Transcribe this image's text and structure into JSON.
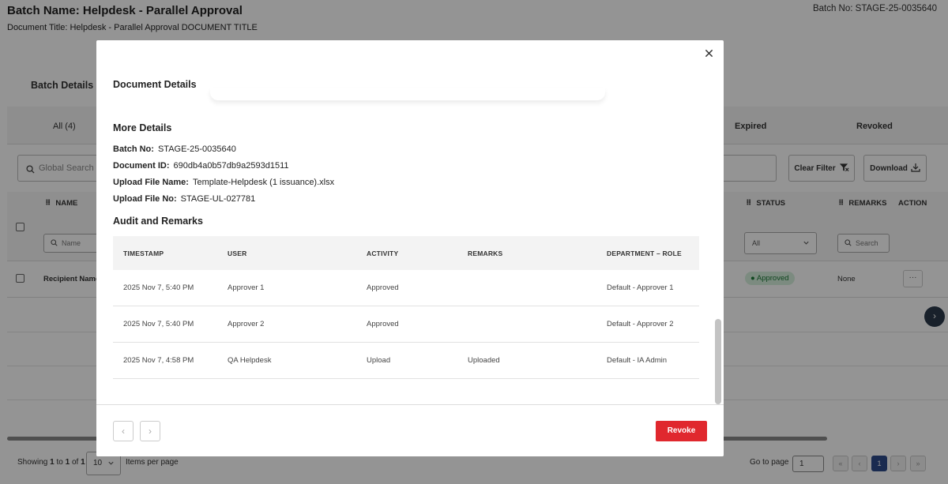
{
  "page": {
    "batch_name": "Batch Name: Helpdesk - Parallel Approval",
    "document_title": "Document Title: Helpdesk - Parallel Approval DOCUMENT TITLE",
    "batch_no": "Batch No: STAGE-25-0035640",
    "tab_batch_details": "Batch Details",
    "tab_all": "All (4)",
    "tab_expired": "Expired",
    "tab_revoked": "Revoked",
    "global_search_placeholder": "Global Search",
    "clear_filter_label": "Clear Filter",
    "download_label": "Download",
    "columns": {
      "name": "NAME",
      "status": "STATUS",
      "remarks": "REMARKS",
      "action": "ACTION"
    },
    "filters": {
      "name_placeholder": "Name",
      "status_value": "All",
      "remarks_placeholder": "Search"
    },
    "row": {
      "recipient": "Recipient Name",
      "status": "Approved",
      "remarks": "None",
      "action": "···"
    },
    "pagination": {
      "showing_prefix": "Showing",
      "showing_from": "1",
      "showing_to_word": "to",
      "showing_to": "1",
      "showing_of_word": "of",
      "showing_total": "1",
      "per_page_value": "10",
      "per_page_label": "Items per page",
      "goto_label": "Go to page",
      "goto_value": "1",
      "current_page": "1"
    }
  },
  "modal": {
    "document_details_title": "Document Details",
    "more_details_title": "More Details",
    "details": [
      {
        "label": "Batch No:",
        "value": "STAGE-25-0035640"
      },
      {
        "label": "Document ID:",
        "value": "690db4a0b57db9a2593d1511"
      },
      {
        "label": "Upload File Name:",
        "value": "Template-Helpdesk (1 issuance).xlsx"
      },
      {
        "label": "Upload File No:",
        "value": "STAGE-UL-027781"
      }
    ],
    "audit_title": "Audit and Remarks",
    "audit_headers": [
      "TIMESTAMP",
      "USER",
      "ACTIVITY",
      "REMARKS",
      "DEPARTMENT – ROLE"
    ],
    "audit_rows": [
      [
        "2025 Nov 7, 5:40 PM",
        "Approver 1",
        "Approved",
        "",
        "Default - Approver 1"
      ],
      [
        "2025 Nov 7, 5:40 PM",
        "Approver 2",
        "Approved",
        "",
        "Default - Approver 2"
      ],
      [
        "2025 Nov 7, 4:58 PM",
        "QA Helpdesk",
        "Upload",
        "Uploaded",
        "Default - IA Admin"
      ]
    ],
    "revoke_label": "Revoke"
  },
  "colors": {
    "revoke": "#e0282e",
    "approved_badge_bg": "#d6efdc",
    "approved_badge_text": "#1d7a38",
    "active_page": "#2d4a8a"
  }
}
